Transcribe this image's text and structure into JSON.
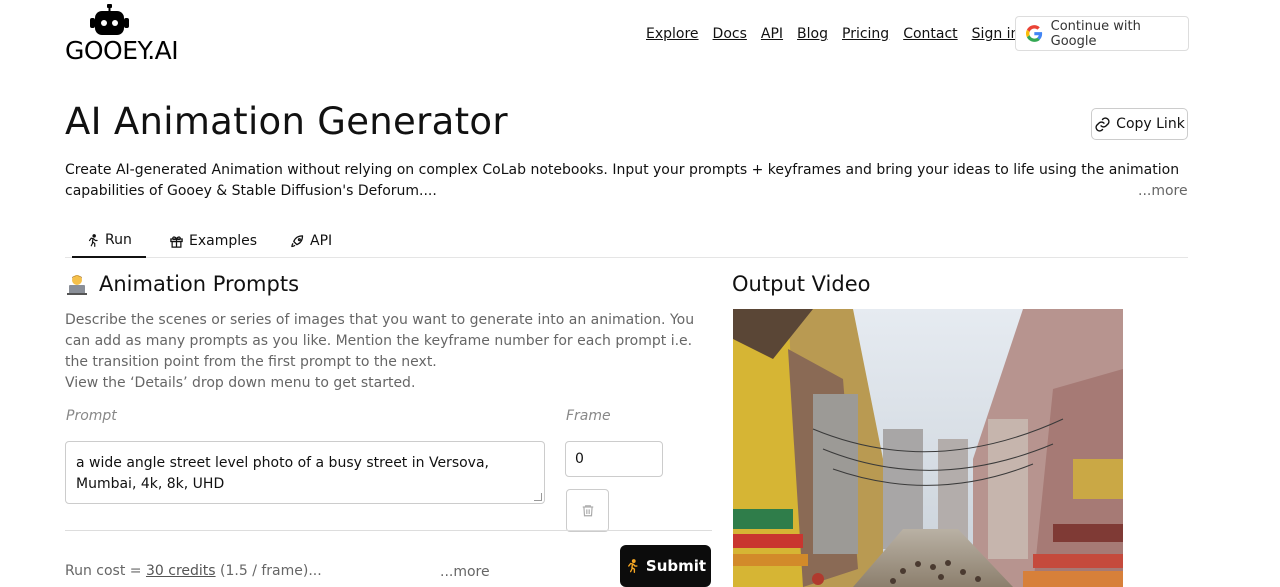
{
  "header": {
    "logo_text": "GOOEY.AI",
    "nav": [
      "Explore",
      "Docs",
      "API",
      "Blog",
      "Pricing",
      "Contact",
      "Sign in"
    ],
    "google_button": "Continue with Google"
  },
  "page": {
    "title": "AI Animation Generator",
    "copy_link": "Copy Link",
    "description": "Create AI-generated Animation without relying on complex CoLab notebooks. Input your prompts + keyframes and bring your ideas to life using the animation capabilities of Gooey & Stable Diffusion's Deforum....",
    "more": "...more"
  },
  "tabs": [
    {
      "label": "Run",
      "icon": "runner-icon"
    },
    {
      "label": "Examples",
      "icon": "gift-icon"
    },
    {
      "label": "API",
      "icon": "rocket-icon"
    }
  ],
  "prompts_section": {
    "title": "Animation Prompts",
    "instructions_line1": "Describe the scenes or series of images that you want to generate into an animation. You can add as many prompts as you like. Mention the keyframe number for each prompt i.e. the transition point from the first prompt to the next.",
    "instructions_line2": "View the ‘Details’ drop down menu to get started.",
    "prompt_label": "Prompt",
    "frame_label": "Frame",
    "prompt_value": "a wide angle street level photo of a busy street in Versova, Mumbai, 4k, 8k, UHD",
    "frame_value": "0"
  },
  "run": {
    "cost_prefix": "Run cost = ",
    "credits": "30 credits",
    "per_frame": " (1.5 / frame)...",
    "more": "...more",
    "submit": "Submit"
  },
  "output": {
    "title": "Output Video"
  },
  "colors": {
    "submit_bg": "#0c0c0c",
    "muted_text": "#666666"
  }
}
